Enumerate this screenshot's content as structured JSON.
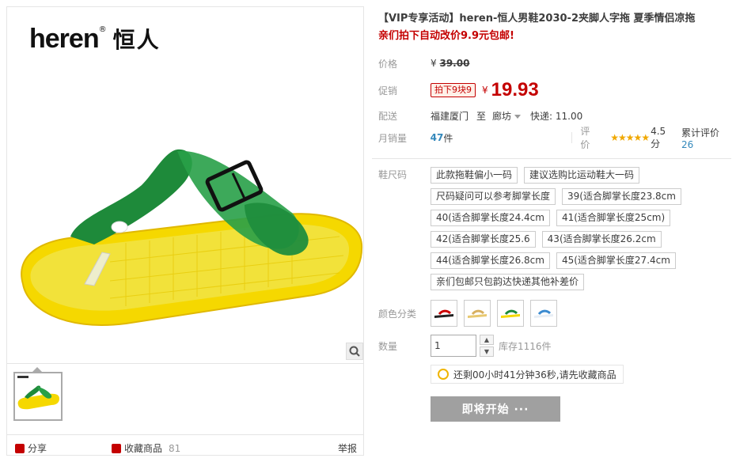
{
  "brand": {
    "logo_en": "heren",
    "logo_reg": "®",
    "logo_cn": "恒人"
  },
  "product": {
    "title": "【VIP专享活动】heren-恒人男鞋2030-2夹脚人字拖 夏季情侣凉拖",
    "subtitle": "亲们拍下自动改价9.9元包邮!"
  },
  "price": {
    "label": "价格",
    "currency": "¥",
    "value": "39.00"
  },
  "promo": {
    "label": "促销",
    "tag": "拍下9块9",
    "currency": "¥",
    "value": "19.93"
  },
  "shipping": {
    "label": "配送",
    "from": "福建厦门",
    "to_word": "至",
    "to": "廊坊",
    "express": "快递: 11.00"
  },
  "sales": {
    "label": "月销量",
    "count": "47",
    "unit": "件",
    "rating_label": "评价",
    "stars": "★★★★★",
    "score": "4.5分",
    "reviews_prefix": "累计评价",
    "reviews_count": "26"
  },
  "size": {
    "label": "鞋尺码",
    "options": [
      "此款拖鞋偏小一码",
      "建议选购比运动鞋大一码",
      "尺码疑问可以参考脚掌长度",
      "39(适合脚掌长度23.8cm",
      "40(适合脚掌长度24.4cm",
      "41(适合脚掌长度25cm)",
      "42(适合脚掌长度25.6",
      "43(适合脚掌长度26.2cm",
      "44(适合脚掌长度26.8cm",
      "45(适合脚掌长度27.4cm",
      "亲们包邮只包韵达快递其他补差价"
    ]
  },
  "color": {
    "label": "颜色分类"
  },
  "quantity": {
    "label": "数量",
    "value": "1",
    "stock": "库存1116件",
    "up": "▲",
    "down": "▼"
  },
  "notice": {
    "text": "还剩00小时41分钟36秒,请先收藏商品"
  },
  "buy_button": "即将开始 ···",
  "actions": {
    "share": "分享",
    "favorite": "收藏商品",
    "favorite_count": "81",
    "report": "举报"
  },
  "colors": {
    "accent": "#c40000",
    "link": "#3388bb",
    "button": "#a0a0a0"
  }
}
